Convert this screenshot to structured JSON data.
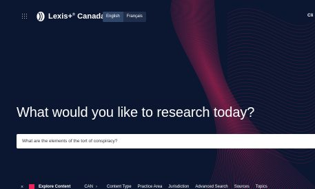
{
  "header": {
    "brand": "Lexis+",
    "brand_mark": "®",
    "region": "Canada",
    "languages": [
      {
        "label": "English",
        "active": true
      },
      {
        "label": "Français",
        "active": false
      }
    ],
    "right_text": "Cli"
  },
  "main": {
    "heading": "What would you like to research today?",
    "search_value": "What are the elements of the tort of conspiracy?"
  },
  "bottom_bar": {
    "explore_label": "Explore Content",
    "jurisdiction_label": "CAN",
    "links": [
      "Content Type",
      "Practice Area",
      "Jurisdiction",
      "Advanced Search",
      "Sources",
      "Topics"
    ]
  },
  "colors": {
    "background": "#0b1730",
    "accent": "#e8265b",
    "wave": "#d9245a"
  },
  "icons": {
    "apps": "grid-icon",
    "logo": "lexis-logo",
    "collapse": "close-icon",
    "chevron": "chevron-right-icon"
  }
}
